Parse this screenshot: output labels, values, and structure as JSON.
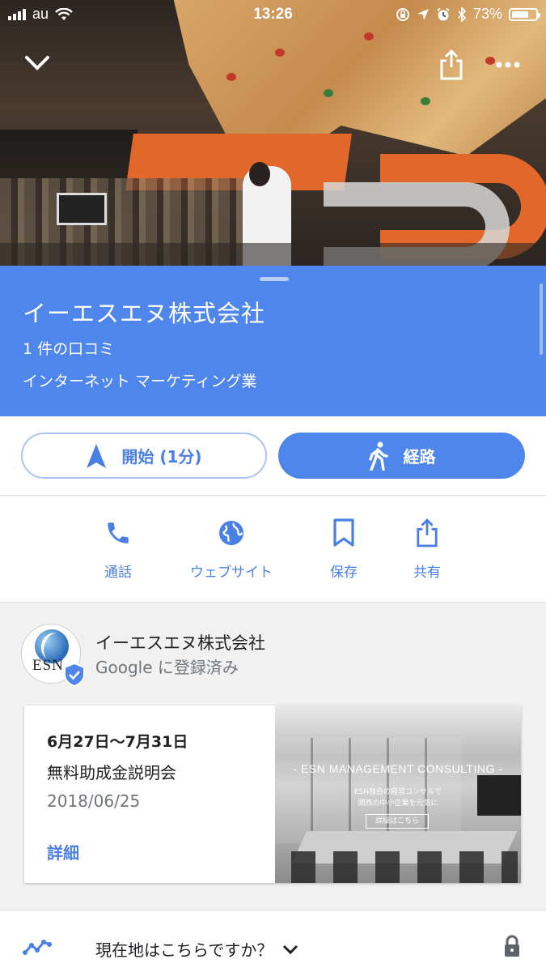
{
  "status_bar": {
    "carrier": "au",
    "time": "13:26",
    "battery": "73%",
    "battery_level": 0.73
  },
  "header": {
    "collapse_icon": "chevron-down-icon",
    "share_icon": "share-icon",
    "more_icon": "more-horizontal-icon"
  },
  "place": {
    "name": "イーエスエヌ株式会社",
    "reviews": "1 件の口コミ",
    "category": "インターネット マーケティング業"
  },
  "actions": {
    "start_label": "開始 (1分)",
    "route_label": "経路"
  },
  "quick_actions": [
    {
      "label": "通話",
      "icon": "phone-icon"
    },
    {
      "label": "ウェブサイト",
      "icon": "globe-icon"
    },
    {
      "label": "保存",
      "icon": "bookmark-icon"
    },
    {
      "label": "共有",
      "icon": "share-icon"
    }
  ],
  "owner": {
    "name": "イーエスエヌ株式会社",
    "verified": "Google に登録済み",
    "logo_text": "ESN"
  },
  "post": {
    "date_range": "6月27日〜7月31日",
    "title": "無料助成金説明会",
    "posted": "2018/06/25",
    "more_label": "詳細",
    "image_banner": "- ESN MANAGEMENT CONSULTING -",
    "image_line1": "ESN独自の経営コンサルで",
    "image_line2": "関西の中小企業を元気に",
    "image_cta": "詳細はこちら"
  },
  "location_prompt": {
    "question": "現在地はこちらですか？"
  },
  "colors": {
    "accent": "#4f86ec",
    "link": "#4a7fe6"
  }
}
